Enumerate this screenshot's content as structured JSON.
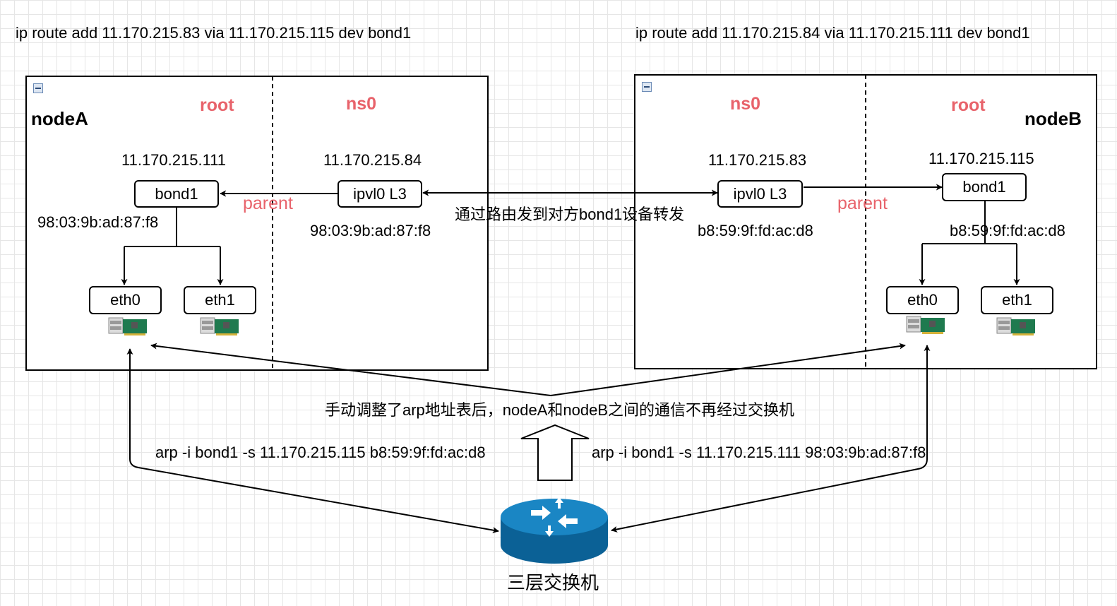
{
  "routes": {
    "left": "ip route add 11.170.215.83 via 11.170.215.115 dev bond1",
    "right": "ip route add 11.170.215.84 via 11.170.215.111 dev bond1"
  },
  "nodeA": {
    "name": "nodeA",
    "root_label": "root",
    "ns_label": "ns0",
    "bond_ip": "11.170.215.111",
    "bond_label": "bond1",
    "bond_mac": "98:03:9b:ad:87:f8",
    "ipvl_ip": "11.170.215.84",
    "ipvl_label": "ipvl0 L3",
    "ipvl_mac": "98:03:9b:ad:87:f8",
    "parent_label": "parent",
    "eth0": "eth0",
    "eth1": "eth1"
  },
  "nodeB": {
    "name": "nodeB",
    "root_label": "root",
    "ns_label": "ns0",
    "bond_ip": "11.170.215.115",
    "bond_label": "bond1",
    "bond_mac": "b8:59:9f:fd:ac:d8",
    "ipvl_ip": "11.170.215.83",
    "ipvl_label": "ipvl0 L3",
    "ipvl_mac": "b8:59:9f:fd:ac:d8",
    "parent_label": "parent",
    "eth0": "eth0",
    "eth1": "eth1"
  },
  "center_note": "通过路由发到对方bond1设备转发",
  "arp_note": "手动调整了arp地址表后，nodeA和nodeB之间的通信不再经过交换机",
  "arp_cmd_left": "arp -i bond1 -s 11.170.215.115 b8:59:9f:fd:ac:d8",
  "arp_cmd_right": "arp -i bond1 -s 11.170.215.111 98:03:9b:ad:87:f8",
  "switch_label": "三层交换机",
  "icons": [
    "collapse-icon",
    "network-card-icon",
    "router-icon"
  ],
  "colors": {
    "namespace_label": "#e8636b",
    "router": "#0b6196"
  }
}
